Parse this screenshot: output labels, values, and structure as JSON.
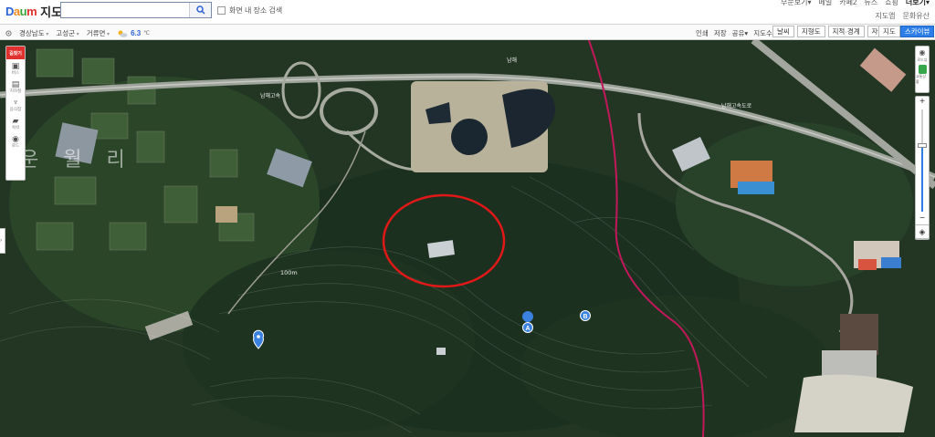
{
  "header": {
    "brand_d": "D",
    "brand_a": "a",
    "brand_u": "u",
    "brand_m": "m",
    "service": "지도",
    "search_placeholder": "",
    "in_map_search": "화면 내 장소 검색",
    "top_links": [
      "부문보기▾",
      "메일",
      "카페2",
      "뉴스",
      "쇼핑",
      "더보기▾"
    ],
    "sub_links": [
      "지도앱",
      "문화유산"
    ]
  },
  "toolbar": {
    "breadcrumb": [
      "경상남도",
      "고성군",
      "거류면"
    ],
    "weather_value": "6.3",
    "weather_unit": "℃",
    "tools": [
      "인쇄",
      "저장",
      "공유▾",
      "지도수정"
    ],
    "layers": [
      "날씨",
      "지형도",
      "지적·경계",
      "자전거"
    ],
    "map_types": [
      "지도",
      "스카이뷰"
    ],
    "active_map_type": "스카이뷰"
  },
  "left_panel": {
    "top": "길찾기",
    "items": [
      {
        "label": "버스",
        "icon": "bus-icon",
        "glyph": "▣"
      },
      {
        "label": "지하철",
        "icon": "subway-icon",
        "glyph": "▤"
      },
      {
        "label": "음식점",
        "icon": "restaurant-icon",
        "glyph": "♆"
      },
      {
        "label": "숙박",
        "icon": "hotel-icon",
        "glyph": "▰"
      },
      {
        "label": "로드",
        "icon": "roadview-icon",
        "glyph": "◉"
      }
    ]
  },
  "right_panel": {
    "roadview": "로드뷰",
    "street": "교통상황",
    "zoom_in": "+",
    "zoom_out": "−",
    "zoom_level_fraction": 0.35
  },
  "map": {
    "area_label": "운 월 리",
    "elevation_label": "100m",
    "road_label_1": "남해고속",
    "road_label_2": "남해고속도로",
    "road_label_3": "남해",
    "marker_a": "A",
    "marker_b": "B"
  },
  "colors": {
    "accent": "#2e7ee8",
    "highlight_circle": "#e01818",
    "boundary": "#c2185b"
  }
}
